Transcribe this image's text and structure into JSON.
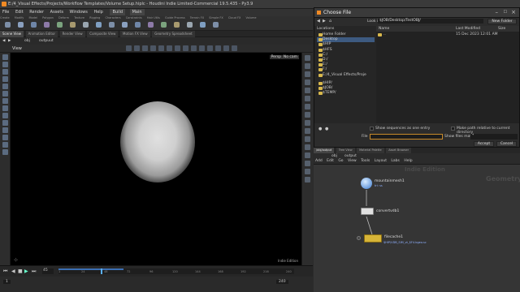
{
  "window": {
    "title": "E:/4_Visual Effects/Projects/Workflow Templates/Volume Setup.hiplc - Houdini Indie Limited-Commercial 19.5.435 - Py3.9"
  },
  "menu": {
    "items": [
      "File",
      "Edit",
      "Render",
      "Assets",
      "Windows",
      "Help"
    ],
    "build": "Build",
    "desk": "Main"
  },
  "shelf_tabs": [
    "Create",
    "Modify",
    "Model",
    "Polygon",
    "Deform",
    "Texture",
    "Rigging",
    "Characters",
    "Constraints",
    "Hair Utils",
    "Guide Process",
    "Terrain FX",
    "Simple FX",
    "Cloud FX",
    "Volume"
  ],
  "shelf_tools": [
    "Box",
    "Sphere",
    "Tube",
    "Torus",
    "Grid",
    "Null",
    "Line",
    "Circle",
    "Curve",
    "Draw Curve",
    "Path",
    "Spray Paint",
    "Font",
    "Platonic",
    "L-System",
    "Metaball",
    "File"
  ],
  "light_tabs": [
    "Lights and Cameras",
    "Collisions",
    "Particles"
  ],
  "pane_tabs": [
    "Scene View",
    "Animation Editor",
    "Render View",
    "Composite View",
    "Motion FX View",
    "Geometry Spreadsheet"
  ],
  "viewport": {
    "path_obj": "obj",
    "path_node": "outpuut",
    "label": "View",
    "persp": "Persp",
    "cam": "No cam",
    "indie": "Indie Edition"
  },
  "timeline": {
    "frame": "45",
    "start": "1",
    "end": "240",
    "ticks": [
      "1",
      "24",
      "48",
      "72",
      "96",
      "120",
      "144",
      "168",
      "192",
      "216",
      "240"
    ]
  },
  "status": {
    "keys": "0 keys, 0/0 channels",
    "keyall": "Key All Channels",
    "auto": "Auto Update"
  },
  "dialog": {
    "title": "Choose File",
    "look_in_label": "Look in",
    "look_in_value": "$JOB/Desktop/TestOBJ/",
    "new_folder": "New Folder",
    "locations_label": "Locations",
    "locations": [
      "Home Folder",
      "Desktop",
      "$HIP",
      "$HFS",
      "C:/",
      "D:/",
      "E:/",
      "F:/",
      "E:/4_Visual Effects/Proje",
      "$HIP/",
      "$JOB/",
      "$TEMP/"
    ],
    "columns": [
      "Name",
      "Last Modified",
      "Size"
    ],
    "file_row": {
      "name": "..",
      "modified": "15 Dec 2023 12:01 AM"
    },
    "show_sequences": "Show sequences as one entry",
    "make_relative": "Make path relative to current directory",
    "file_label": "File",
    "file_value": "",
    "show_matching": "Show files matching",
    "show_matching_value": "*",
    "accept": "Accept",
    "cancel": "Cancel"
  },
  "network": {
    "tabs": [
      "/obj/output",
      "Tree View",
      "Material Palette",
      "Asset Browser"
    ],
    "path_obj": "obj",
    "path_node": "output",
    "menus": [
      "Add",
      "Edit",
      "Go",
      "View",
      "Tools",
      "Layout",
      "Labs",
      "Help"
    ],
    "indie": "Indie Edition",
    "context": "Geometry",
    "nodes": [
      {
        "name": "mountainmesh1",
        "sub": "tri: ss"
      },
      {
        "name": "convertvdb1",
        "sub": ""
      },
      {
        "name": "filecache1",
        "sub": "$HIP/VDB_SIM_vt_$F4.bgeo.sc"
      }
    ]
  }
}
